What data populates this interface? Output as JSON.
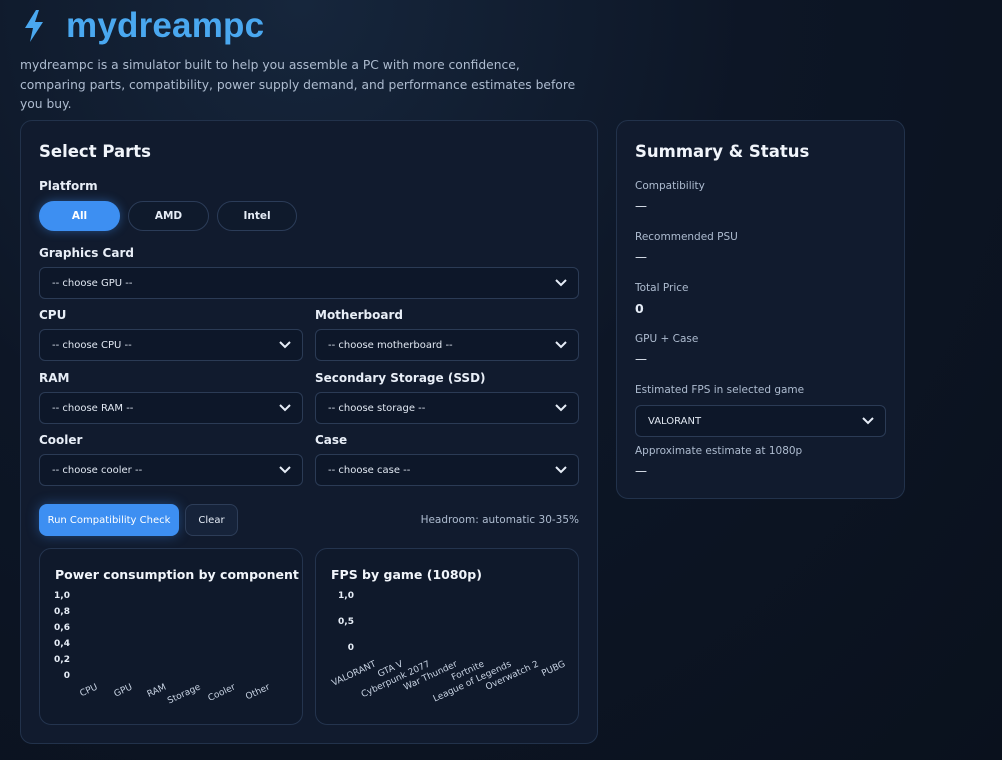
{
  "brand": {
    "title": "mydreampc",
    "tagline": "mydreampc is a simulator built to help you assemble a PC with more confidence, comparing parts, compatibility, power supply demand, and performance estimates before you buy."
  },
  "select_parts": {
    "title": "Select Parts",
    "platform_label": "Platform",
    "platforms": [
      "All",
      "AMD",
      "Intel"
    ],
    "gpu": {
      "label": "Graphics Card",
      "value": "-- choose GPU --"
    },
    "cpu": {
      "label": "CPU",
      "value": "-- choose CPU --"
    },
    "motherboard": {
      "label": "Motherboard",
      "value": "-- choose motherboard --"
    },
    "ram": {
      "label": "RAM",
      "value": "-- choose RAM --"
    },
    "storage": {
      "label": "Secondary Storage (SSD)",
      "value": "-- choose storage --"
    },
    "cooler": {
      "label": "Cooler",
      "value": "-- choose cooler --"
    },
    "case": {
      "label": "Case",
      "value": "-- choose case --"
    },
    "run_button": "Run Compatibility Check",
    "clear_button": "Clear",
    "headroom": "Headroom: automatic 30-35%"
  },
  "chart_data": [
    {
      "type": "bar",
      "title": "Power consumption by component",
      "categories": [
        "CPU",
        "GPU",
        "RAM",
        "Storage",
        "Cooler",
        "Other"
      ],
      "values": [],
      "yticks": [
        "1,0",
        "0,8",
        "0,6",
        "0,4",
        "0,2",
        "0"
      ],
      "ylim": [
        0,
        1.0
      ]
    },
    {
      "type": "bar",
      "title": "FPS by game (1080p)",
      "categories": [
        "VALORANT",
        "GTA V",
        "Cyberpunk 2077",
        "War Thunder",
        "Fortnite",
        "League of Legends",
        "Overwatch 2",
        "PUBG"
      ],
      "values": [],
      "yticks": [
        "1,0",
        "0,5",
        "0"
      ],
      "ylim": [
        0,
        1.0
      ]
    }
  ],
  "summary": {
    "title": "Summary & Status",
    "compatibility": {
      "label": "Compatibility",
      "value": "—"
    },
    "psu": {
      "label": "Recommended PSU",
      "value": "—"
    },
    "price": {
      "label": "Total Price",
      "value": "0"
    },
    "gpu_case": {
      "label": "GPU + Case",
      "value": "—"
    },
    "fps": {
      "label": "Estimated FPS in selected game",
      "game": "VALORANT"
    },
    "approx": {
      "label": "Approximate estimate at 1080p",
      "value": "—"
    }
  },
  "colors": {
    "accent": "#3d8ff2",
    "brand": "#4aa8f0"
  }
}
